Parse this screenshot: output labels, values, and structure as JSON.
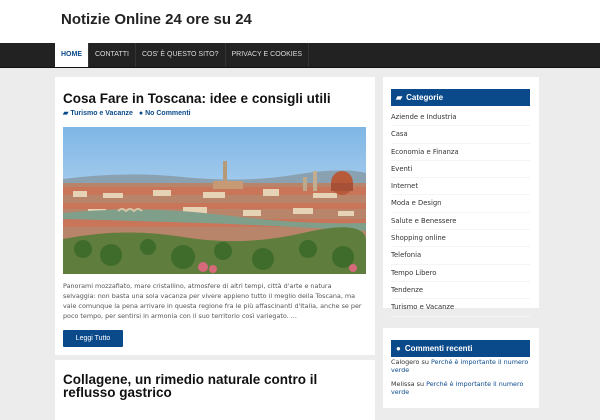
{
  "site": {
    "title": "Notizie Online 24 ore su 24"
  },
  "nav": {
    "items": [
      "HOME",
      "CONTATTI",
      "COS' È QUESTO SITO?",
      "PRIVACY E COOKIES"
    ]
  },
  "posts": [
    {
      "title": "Cosa Fare in Toscana: idee e consigli utili",
      "category": "Turismo e Vacanze",
      "comments": "No Commenti",
      "excerpt": "Panorami mozzafiato, mare cristallino, atmosfere di altri tempi, città d'arte e natura selvaggia: non basta una sola vacanza per vivere appieno tutto il meglio della Toscana, ma vale comunque la pena arrivare in questa regione fra le più affascinanti d'Italia, anche se per poco tempo, per sentirsi in armonia con il suo territorio così variegato. ...",
      "read_more": "Leggi Tutto"
    },
    {
      "title": "Collagene, un rimedio naturale contro il reflusso gastrico"
    }
  ],
  "sidebar": {
    "categories": {
      "title": "Categorie",
      "items": [
        "Aziende e Industria",
        "Casa",
        "Economia e Finanza",
        "Eventi",
        "Internet",
        "Moda e Design",
        "Salute e Benessere",
        "Shopping online",
        "Telefonia",
        "Tempo Libero",
        "Tendenze",
        "Turismo e Vacanze"
      ]
    },
    "recent_comments": {
      "title": "Commenti recenti",
      "items": [
        {
          "author": "Calogero",
          "sep": "su",
          "post": "Perché è importante il numero verde"
        },
        {
          "author": "Melissa",
          "sep": "su",
          "post": "Perché è importante il numero verde"
        }
      ]
    }
  },
  "colors": {
    "accent": "#0b4a8a",
    "nav_bg": "#222222",
    "page_bg": "#ececec"
  },
  "icons": {
    "category": "folder-icon",
    "comments": "comment-icon"
  }
}
